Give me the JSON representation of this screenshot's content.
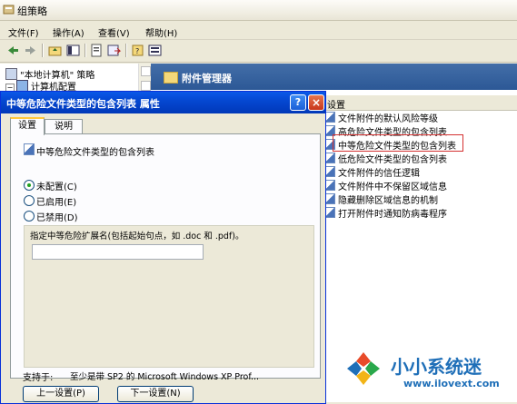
{
  "window": {
    "title": "组策略",
    "menu": [
      "文件(F)",
      "操作(A)",
      "查看(V)",
      "帮助(H)"
    ]
  },
  "tree": {
    "root": "\"本地计算机\" 策略",
    "child": "计算机配置"
  },
  "right_pane": {
    "folder_title": "附件管理器",
    "column_header": "设置",
    "items": [
      "文件附件的默认风险等级",
      "高危险文件类型的包含列表",
      "中等危险文件类型的包含列表",
      "低危险文件类型的包含列表",
      "文件附件的信任逻辑",
      "文件附件中不保留区域信息",
      "隐藏删除区域信息的机制",
      "打开附件时通知防病毒程序"
    ],
    "highlighted_index": 2,
    "highlight_color": "#d43030"
  },
  "dialog": {
    "title": "中等危险文件类型的包含列表 属性",
    "help_label": "?",
    "close_label": "×",
    "tabs": [
      "设置",
      "说明"
    ],
    "policy_name": "中等危险文件类型的包含列表",
    "options": [
      "未配置(C)",
      "已启用(E)",
      "已禁用(D)"
    ],
    "selected_option": 0,
    "hint": "指定中等危险扩展名(包括起始句点，如 .doc 和 .pdf)。",
    "input_value": "",
    "supported_label": "支持于:",
    "supported_value": "至少是带 SP2 的 Microsoft Windows XP Prof...",
    "prev_button": "上一设置(P)",
    "next_button": "下一设置(N)"
  },
  "watermark": {
    "name": "小小系统迷",
    "url": "www.ilovext.com"
  },
  "colors": {
    "dialog_title": "#0548d2",
    "header_blue": "#2c5896",
    "watermark": "#1f6fb8"
  }
}
